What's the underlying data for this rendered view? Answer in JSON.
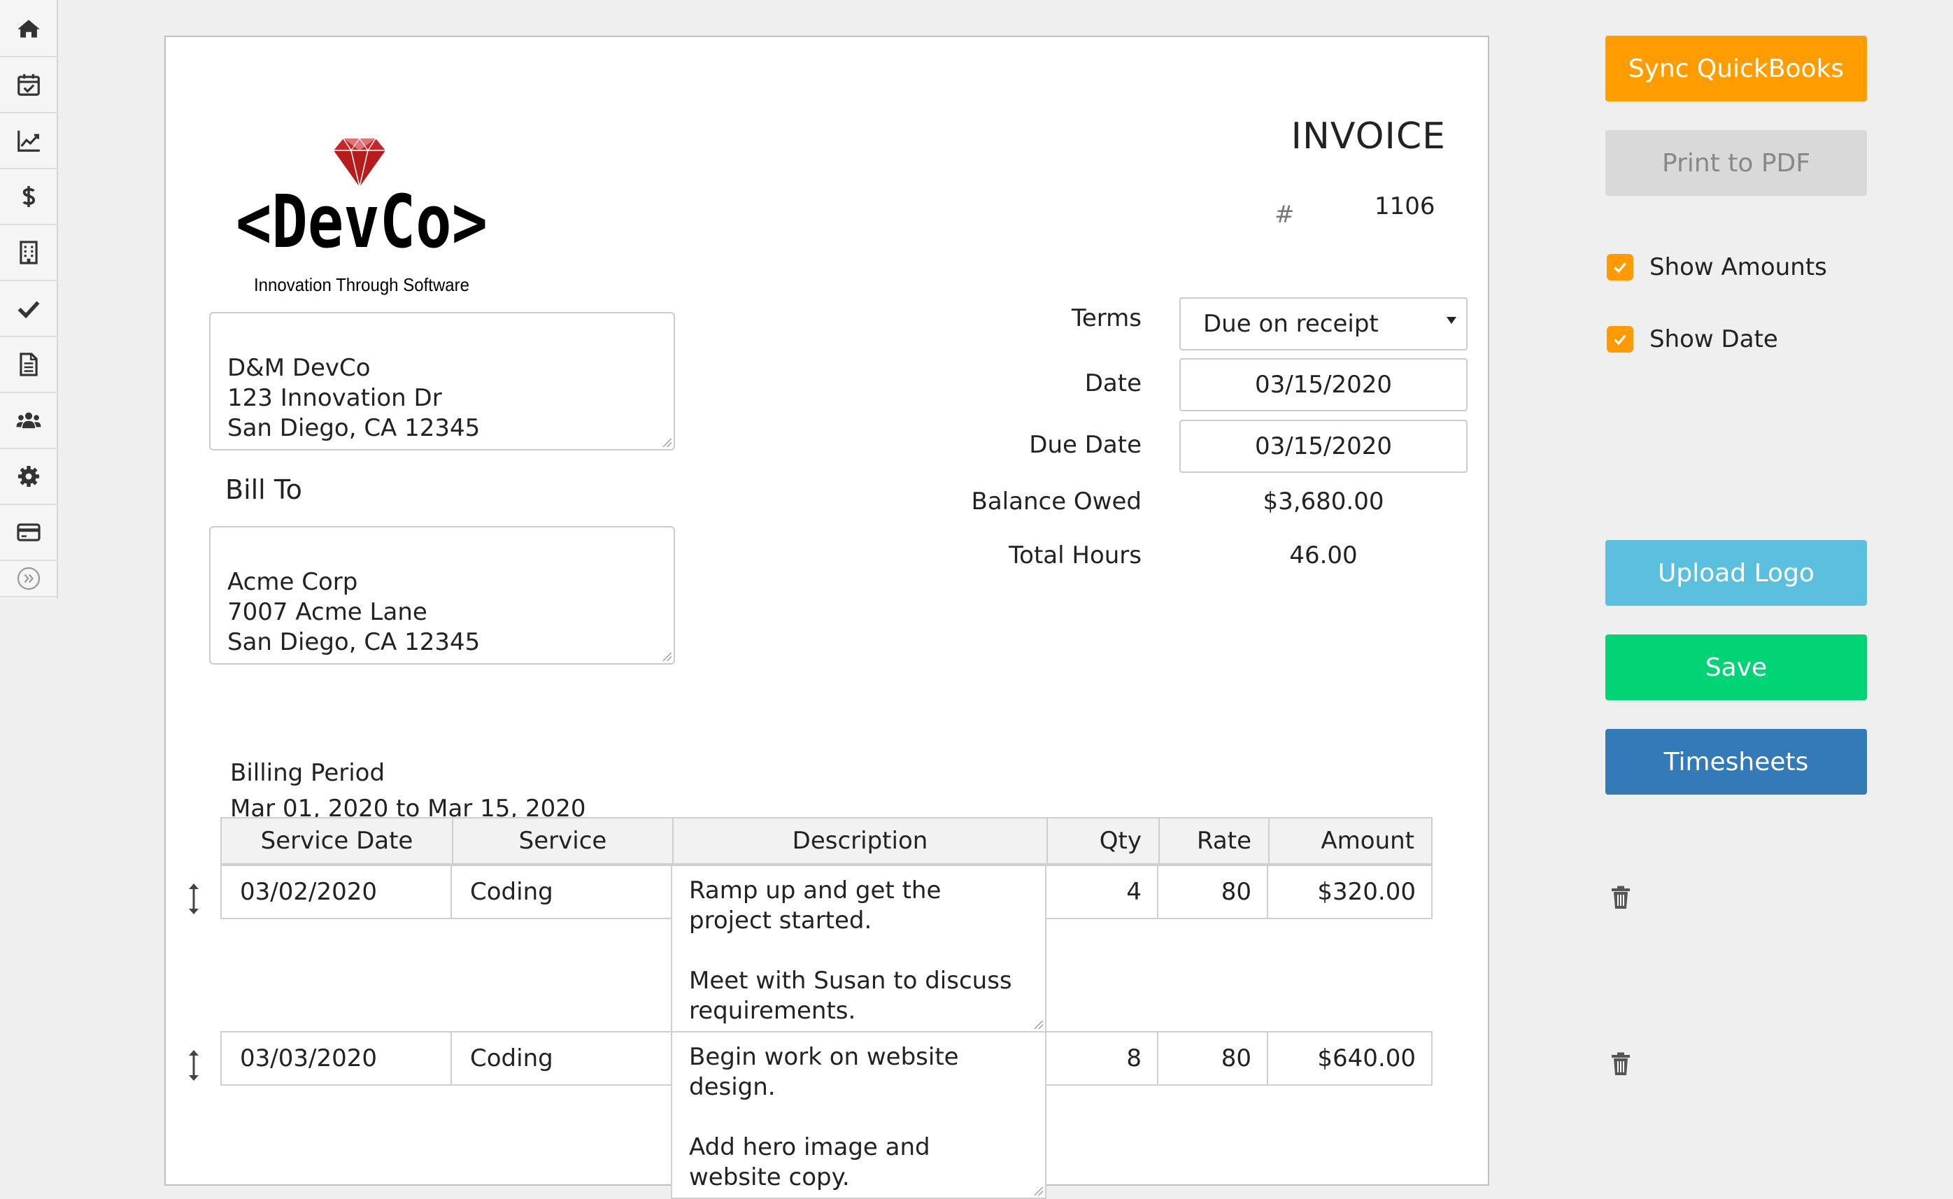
{
  "sidebar": {
    "items": [
      {
        "icon": "home-icon"
      },
      {
        "icon": "calendar-check-icon"
      },
      {
        "icon": "line-chart-icon"
      },
      {
        "icon": "dollar-icon"
      },
      {
        "icon": "building-icon"
      },
      {
        "icon": "checkmark-icon"
      },
      {
        "icon": "document-icon"
      },
      {
        "icon": "users-icon"
      },
      {
        "icon": "gear-icon"
      },
      {
        "icon": "credit-card-icon"
      },
      {
        "icon": "expand-icon"
      }
    ]
  },
  "invoice": {
    "logo": {
      "brand": "<DevCo>",
      "tagline": "Innovation Through Software",
      "gem_color": "#c62828"
    },
    "title": "INVOICE",
    "number_symbol": "#",
    "number": "1106",
    "from_address": "D&M DevCo\n123 Innovation Dr\nSan Diego, CA 12345",
    "bill_to_label": "Bill To",
    "to_address": "Acme Corp\n7007 Acme Lane\nSan Diego, CA 12345",
    "terms_label": "Terms",
    "terms_value": "Due on receipt",
    "date_label": "Date",
    "date_value": "03/15/2020",
    "due_date_label": "Due Date",
    "due_date_value": "03/15/2020",
    "balance_label": "Balance Owed",
    "balance_value": "$3,680.00",
    "hours_label": "Total Hours",
    "hours_value": "46.00",
    "billing_period_label": "Billing Period",
    "billing_period_value": "Mar 01, 2020 to Mar 15, 2020",
    "table": {
      "columns": [
        "Service Date",
        "Service",
        "Description",
        "Qty",
        "Rate",
        "Amount"
      ],
      "rows": [
        {
          "service_date": "03/02/2020",
          "service": "Coding",
          "description": "Ramp up and get the project started.\n\nMeet with Susan to discuss requirements.",
          "qty": "4",
          "rate": "80",
          "amount": "$320.00"
        },
        {
          "service_date": "03/03/2020",
          "service": "Coding",
          "description": "Begin work on website design.\n\nAdd hero image and website copy.",
          "qty": "8",
          "rate": "80",
          "amount": "$640.00"
        }
      ]
    }
  },
  "actions": {
    "sync_label": "Sync QuickBooks",
    "print_label": "Print to PDF",
    "show_amounts_label": "Show Amounts",
    "show_amounts_checked": true,
    "show_date_label": "Show Date",
    "show_date_checked": true,
    "upload_logo_label": "Upload Logo",
    "save_label": "Save",
    "timesheets_label": "Timesheets"
  },
  "colors": {
    "sync": "#ff9c00",
    "print": "#d9d9d9",
    "print_text": "#888888",
    "checkbox": "#ff9a00",
    "upload": "#5bc0de",
    "save": "#00d474",
    "timesheets": "#337ab7"
  }
}
